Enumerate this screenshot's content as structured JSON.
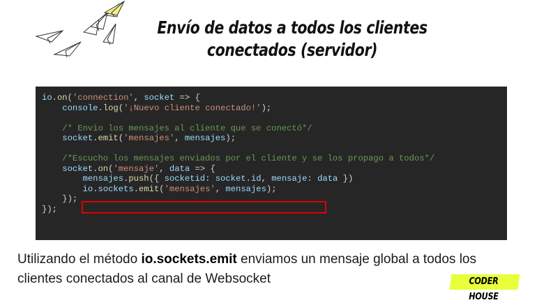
{
  "slide": {
    "title_line1": "Envío de datos a todos los clientes",
    "title_line2": "conectados (servidor)"
  },
  "code": {
    "lines": [
      [
        {
          "t": "io",
          "c": "kw"
        },
        {
          "t": ".",
          "c": "pl"
        },
        {
          "t": "on",
          "c": "fn"
        },
        {
          "t": "(",
          "c": "pl"
        },
        {
          "t": "'connection'",
          "c": "str"
        },
        {
          "t": ", ",
          "c": "pl"
        },
        {
          "t": "socket",
          "c": "kw"
        },
        {
          "t": " => {",
          "c": "pl"
        }
      ],
      [
        {
          "t": "    ",
          "c": "pl"
        },
        {
          "t": "console",
          "c": "kw"
        },
        {
          "t": ".",
          "c": "pl"
        },
        {
          "t": "log",
          "c": "fn"
        },
        {
          "t": "(",
          "c": "pl"
        },
        {
          "t": "'¡Nuevo cliente conectado!'",
          "c": "str"
        },
        {
          "t": ");",
          "c": "pl"
        }
      ],
      [],
      [
        {
          "t": "    ",
          "c": "pl"
        },
        {
          "t": "/* Envio los mensajes al cliente que se conectó*/",
          "c": "cm"
        }
      ],
      [
        {
          "t": "    ",
          "c": "pl"
        },
        {
          "t": "socket",
          "c": "kw"
        },
        {
          "t": ".",
          "c": "pl"
        },
        {
          "t": "emit",
          "c": "fn"
        },
        {
          "t": "(",
          "c": "pl"
        },
        {
          "t": "'mensajes'",
          "c": "str"
        },
        {
          "t": ", ",
          "c": "pl"
        },
        {
          "t": "mensajes",
          "c": "kw"
        },
        {
          "t": ");",
          "c": "pl"
        }
      ],
      [],
      [
        {
          "t": "    ",
          "c": "pl"
        },
        {
          "t": "/*Escucho los mensajes enviados por el cliente y se los propago a todos*/",
          "c": "cm"
        }
      ],
      [
        {
          "t": "    ",
          "c": "pl"
        },
        {
          "t": "socket",
          "c": "kw"
        },
        {
          "t": ".",
          "c": "pl"
        },
        {
          "t": "on",
          "c": "fn"
        },
        {
          "t": "(",
          "c": "pl"
        },
        {
          "t": "'mensaje'",
          "c": "str"
        },
        {
          "t": ", ",
          "c": "pl"
        },
        {
          "t": "data",
          "c": "kw"
        },
        {
          "t": " => {",
          "c": "pl"
        }
      ],
      [
        {
          "t": "        ",
          "c": "pl"
        },
        {
          "t": "mensajes",
          "c": "kw"
        },
        {
          "t": ".",
          "c": "pl"
        },
        {
          "t": "push",
          "c": "fn"
        },
        {
          "t": "({ ",
          "c": "pl"
        },
        {
          "t": "socketid",
          "c": "kw"
        },
        {
          "t": ": ",
          "c": "pl"
        },
        {
          "t": "socket",
          "c": "kw"
        },
        {
          "t": ".",
          "c": "pl"
        },
        {
          "t": "id",
          "c": "kw"
        },
        {
          "t": ", ",
          "c": "pl"
        },
        {
          "t": "mensaje",
          "c": "kw"
        },
        {
          "t": ": ",
          "c": "pl"
        },
        {
          "t": "data",
          "c": "kw"
        },
        {
          "t": " })",
          "c": "pl"
        }
      ],
      [
        {
          "t": "        ",
          "c": "pl"
        },
        {
          "t": "io",
          "c": "kw"
        },
        {
          "t": ".",
          "c": "pl"
        },
        {
          "t": "sockets",
          "c": "kw"
        },
        {
          "t": ".",
          "c": "pl"
        },
        {
          "t": "emit",
          "c": "fn"
        },
        {
          "t": "(",
          "c": "pl"
        },
        {
          "t": "'mensajes'",
          "c": "str"
        },
        {
          "t": ", ",
          "c": "pl"
        },
        {
          "t": "mensajes",
          "c": "kw"
        },
        {
          "t": ");",
          "c": "pl"
        }
      ],
      [
        {
          "t": "    });",
          "c": "pl"
        }
      ],
      [
        {
          "t": "});",
          "c": "pl"
        }
      ]
    ]
  },
  "caption": {
    "prefix": "Utilizando el método ",
    "bold": "io.sockets.emit",
    "suffix": " enviamos un mensaje global a todos los clientes conectados al canal de Websocket"
  },
  "logo": {
    "text": "CODER HOUSE"
  },
  "colors": {
    "accent": "#e8ff3a",
    "code_bg": "#262626",
    "highlight_border": "#e00000"
  },
  "icons": [
    "paper-plane-icon"
  ]
}
